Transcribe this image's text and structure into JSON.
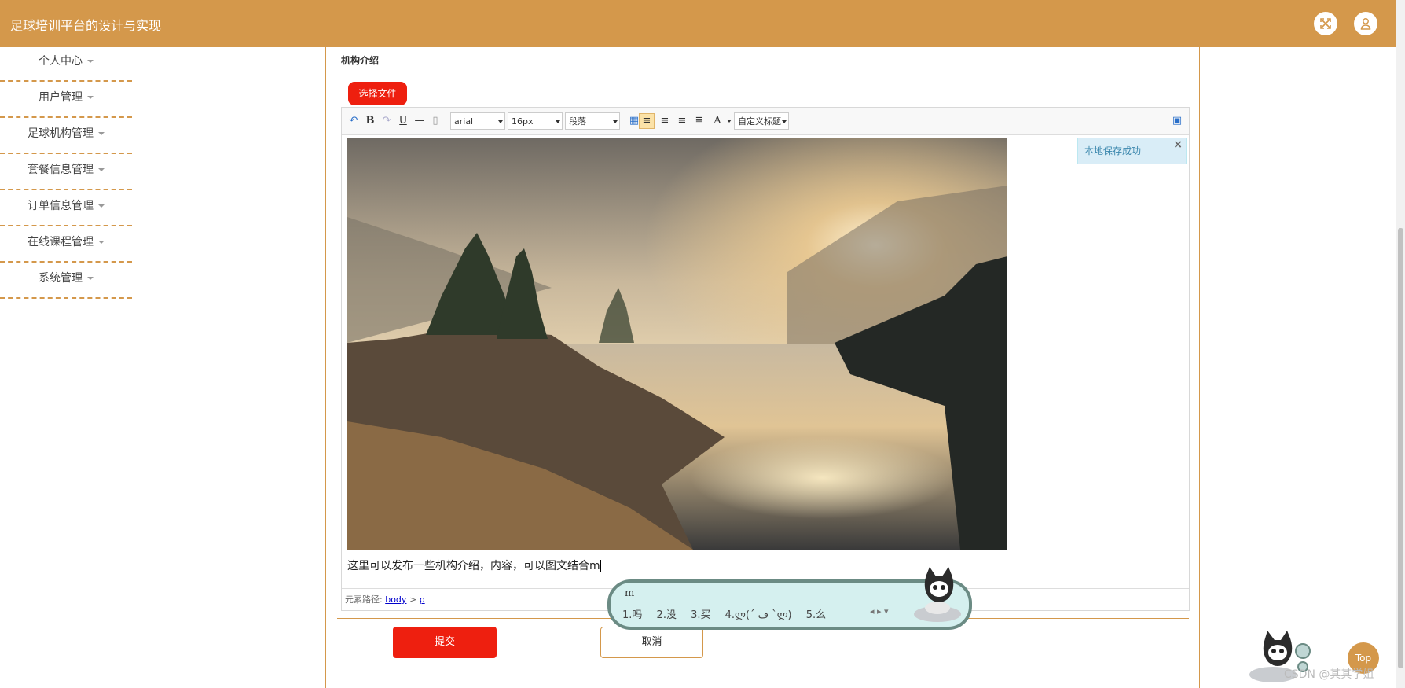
{
  "header": {
    "title": "足球培训平台的设计与实现"
  },
  "sidebar": {
    "items": [
      "个人中心",
      "用户管理",
      "足球机构管理",
      "套餐信息管理",
      "订单信息管理",
      "在线课程管理",
      "系统管理"
    ]
  },
  "form": {
    "section_label": "机构介绍",
    "choose_file_label": "选择文件",
    "submit_label": "提交",
    "cancel_label": "取消"
  },
  "editor": {
    "font_family": "arial",
    "font_size": "16px",
    "paragraph": "段落",
    "custom_heading": "自定义标题",
    "text_color_letter": "A",
    "content_text": "这里可以发布一些机构介绍，内容，可以图文结合m",
    "toast": "本地保存成功",
    "toast_close": "×",
    "path_label": "元素路径:",
    "path_body": "body",
    "path_sep": ">",
    "path_p": "p"
  },
  "ime": {
    "input": "m",
    "candidates": [
      "1.吗",
      "2.没",
      "3.买",
      "4.ლ(´ ڡ `ლ)",
      "5.么"
    ]
  },
  "misc": {
    "top_label": "Top",
    "watermark": "CSDN @其其学姐"
  },
  "colors": {
    "brand": "#d4984b",
    "primary_button": "#ee1f0f",
    "toast_bg": "#d9edf7"
  }
}
